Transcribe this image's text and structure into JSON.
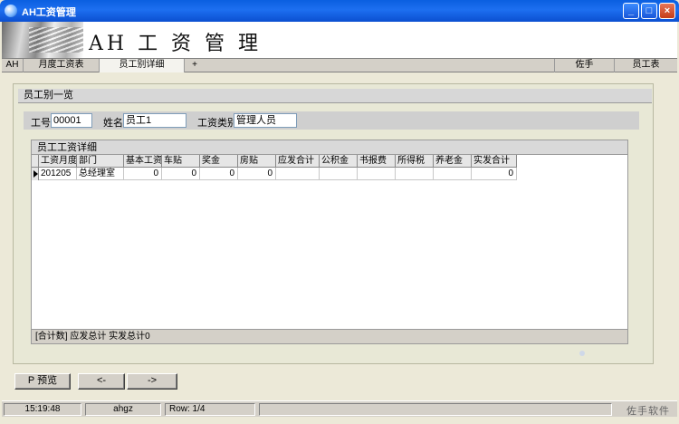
{
  "window": {
    "title": "AH工资管理",
    "btn_min": "_",
    "btn_max": "□",
    "btn_close": "×"
  },
  "banner": {
    "title": "AH 工 资 管 理"
  },
  "tabs": [
    {
      "label": "AH"
    },
    {
      "label": "月度工资表"
    },
    {
      "label": "员工别详细"
    },
    {
      "label": "+"
    }
  ],
  "right_tabs": [
    {
      "label": "佐手"
    },
    {
      "label": "员工表"
    }
  ],
  "panel": {
    "title": "员工别一览"
  },
  "filters": {
    "id_label": "工号",
    "id_value": "00001",
    "name_label": "姓名",
    "name_value": "员工1",
    "type_label": "工资类别",
    "type_value": "管理人员"
  },
  "detail": {
    "title": "员工工资详细",
    "columns": [
      "工资月度",
      "部门",
      "基本工资",
      "车贴",
      "奖金",
      "房贴",
      "应发合计",
      "公积金",
      "书报费",
      "所得税",
      "养老金",
      "实发合计"
    ],
    "rows": [
      [
        "201205",
        "总经理室",
        "0",
        "0",
        "0",
        "0",
        "",
        "",
        "",
        "",
        "",
        "0"
      ]
    ],
    "footer": "[合计数] 应发总计    实发总计0"
  },
  "buttons": {
    "preview": "P 预览",
    "prev": "<-",
    "next": "->"
  },
  "status": {
    "time": "15:19:48",
    "user": "ahgz",
    "row": "Row: 1/4",
    "brand": "佐手软件"
  }
}
